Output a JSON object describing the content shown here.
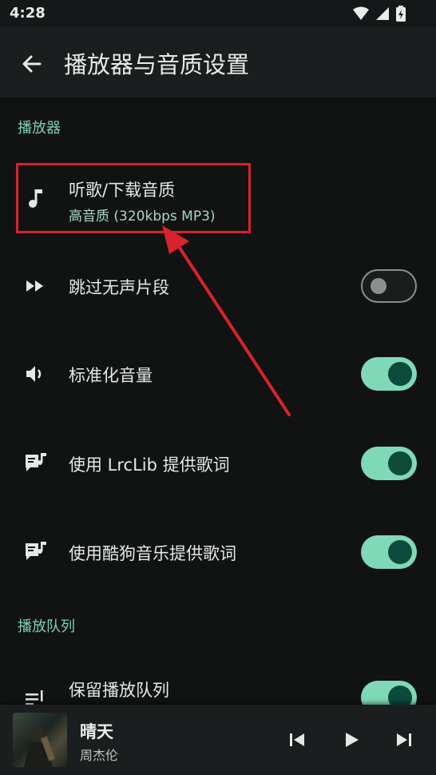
{
  "status": {
    "time": "4:28"
  },
  "app_bar": {
    "title": "播放器与音质设置"
  },
  "sections": [
    {
      "header": "播放器"
    },
    {
      "header": "播放队列"
    }
  ],
  "rows": {
    "audio_quality": {
      "title": "听歌/下载音质",
      "subtitle": "高音质 (320kbps MP3)"
    },
    "skip_silence": {
      "title": "跳过无声片段",
      "enabled": false
    },
    "normalize_volume": {
      "title": "标准化音量",
      "enabled": true
    },
    "lrclib_lyrics": {
      "title": "使用 LrcLib 提供歌词",
      "enabled": true
    },
    "kugou_lyrics": {
      "title": "使用酷狗音乐提供歌词",
      "enabled": true
    },
    "keep_queue": {
      "title": "保留播放队列",
      "enabled": true
    }
  },
  "colors": {
    "accent": "#7fd9b9",
    "section_header": "#7fcfb5",
    "annotation": "#d8222c",
    "background": "#111313"
  },
  "mini_player": {
    "title": "晴天",
    "artist": "周杰伦"
  }
}
